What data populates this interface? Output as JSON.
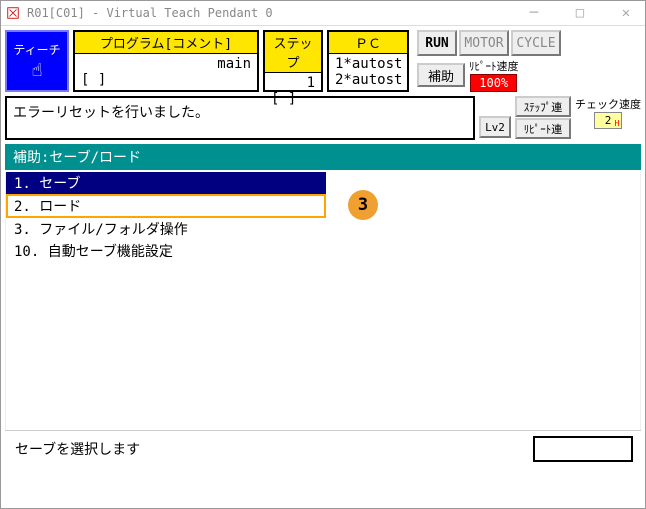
{
  "window": {
    "title": "R01[C01] - Virtual Teach Pendant 0"
  },
  "teach": {
    "label": "ティーチ"
  },
  "program": {
    "head": "プログラム[コメント]",
    "row1": "main",
    "row2": "[              ]"
  },
  "step": {
    "head": "ステップ",
    "row1": "1",
    "row2": "[     ]"
  },
  "pc": {
    "head": "ＰＣ",
    "row1": "1*autost",
    "row2": "2*autost"
  },
  "buttons": {
    "run": "RUN",
    "motor": "MOTOR",
    "cycle": "CYCLE",
    "aux": "補助",
    "lv": "Lv2",
    "step_ren": "ｽﾃｯﾌﾟ連",
    "repeat_ren": "ﾘﾋﾟｰﾄ連"
  },
  "speed": {
    "repeat_label": "ﾘﾋﾟｰﾄ速度",
    "repeat_val": "100%",
    "check_label": "チェック速度",
    "check_val": "2"
  },
  "message": "エラーリセットを行いました。",
  "section_title": "補助:セーブ/ロード",
  "menu": {
    "i1": "1. セーブ",
    "i2": "2. ロード",
    "i3": "3. ファイル/フォルダ操作",
    "i10": "10. 自動セーブ機能設定"
  },
  "callout": "3",
  "status": "セーブを選択します"
}
